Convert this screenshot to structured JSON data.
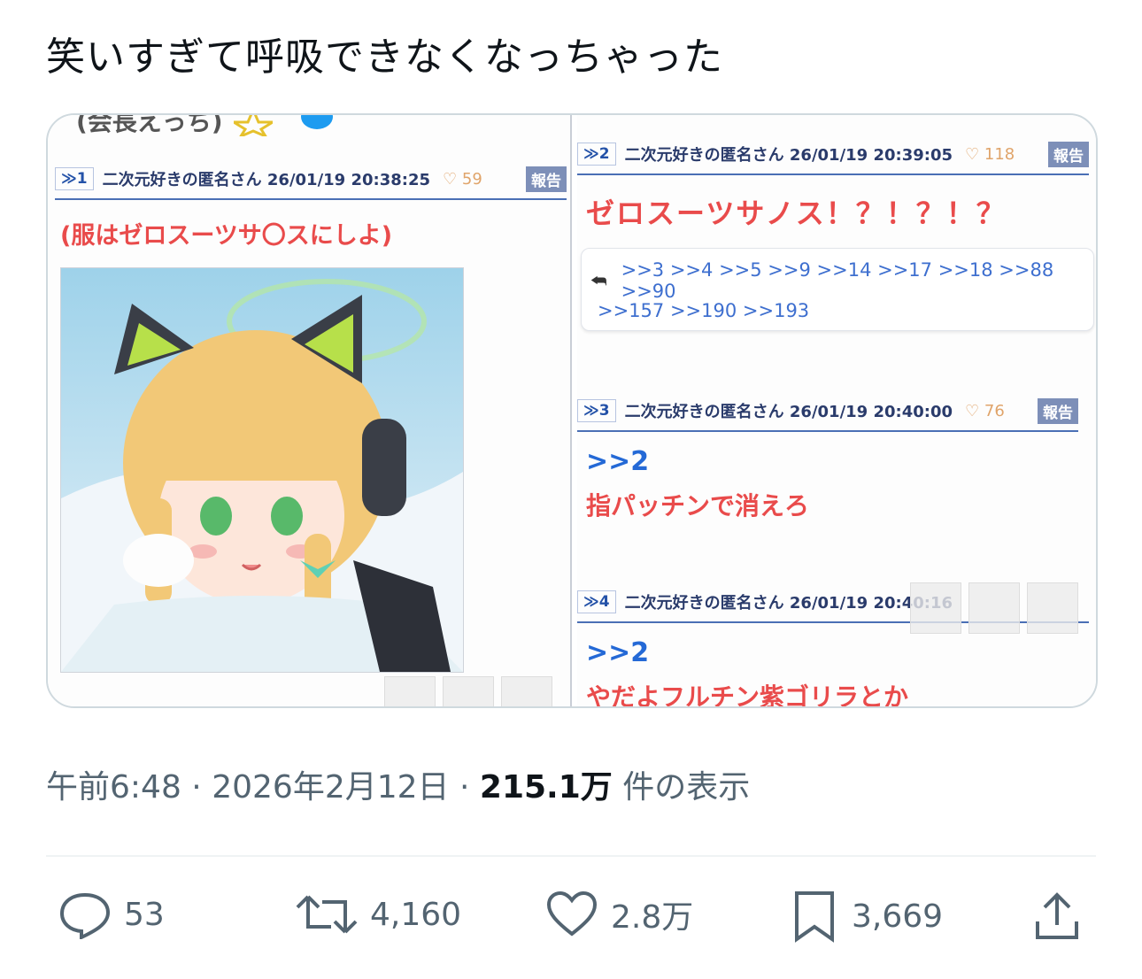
{
  "tweet": {
    "text": "笑いすぎて呼吸できなくなっちゃった"
  },
  "screenshot": {
    "top_partial": "(会長えっち)",
    "posts": [
      {
        "num": "≫1",
        "header": "二次元好きの匿名さん 26/01/19 20:38:25",
        "likes": "59",
        "report": "報告",
        "body": "(服はゼロスーツサ〇スにしよ)"
      },
      {
        "num": "≫2",
        "header": "二次元好きの匿名さん 26/01/19 20:39:05",
        "likes": "118",
        "report": "報告",
        "body": "ゼロスーツサノス！？！？！？",
        "replies_line1": ">>3 >>4 >>5 >>9 >>14 >>17 >>18 >>88 >>90",
        "replies_line2": ">>157 >>190 >>193"
      },
      {
        "num": "≫3",
        "header": "二次元好きの匿名さん 26/01/19 20:40:00",
        "likes": "76",
        "report": "報告",
        "anchor": ">>2",
        "body": "指パッチンで消えろ"
      },
      {
        "num": "≫4",
        "header": "二次元好きの匿名さん 26/01/19 20:40:16",
        "likes": "",
        "report": "",
        "anchor": ">>2",
        "body": "やだよフルチン紫ゴリラとか"
      }
    ]
  },
  "meta": {
    "time": "午前6:48",
    "dot1": "·",
    "date": "2026年2月12日",
    "dot2": "·",
    "views": "215.1万",
    "views_label": "件の表示"
  },
  "actions": {
    "replies": "53",
    "retweets": "4,160",
    "likes": "2.8万",
    "bookmarks": "3,669"
  },
  "colors": {
    "text": "#0f1419",
    "secondary": "#536471",
    "red": "#e94b4b",
    "blue": "#2469d6"
  }
}
